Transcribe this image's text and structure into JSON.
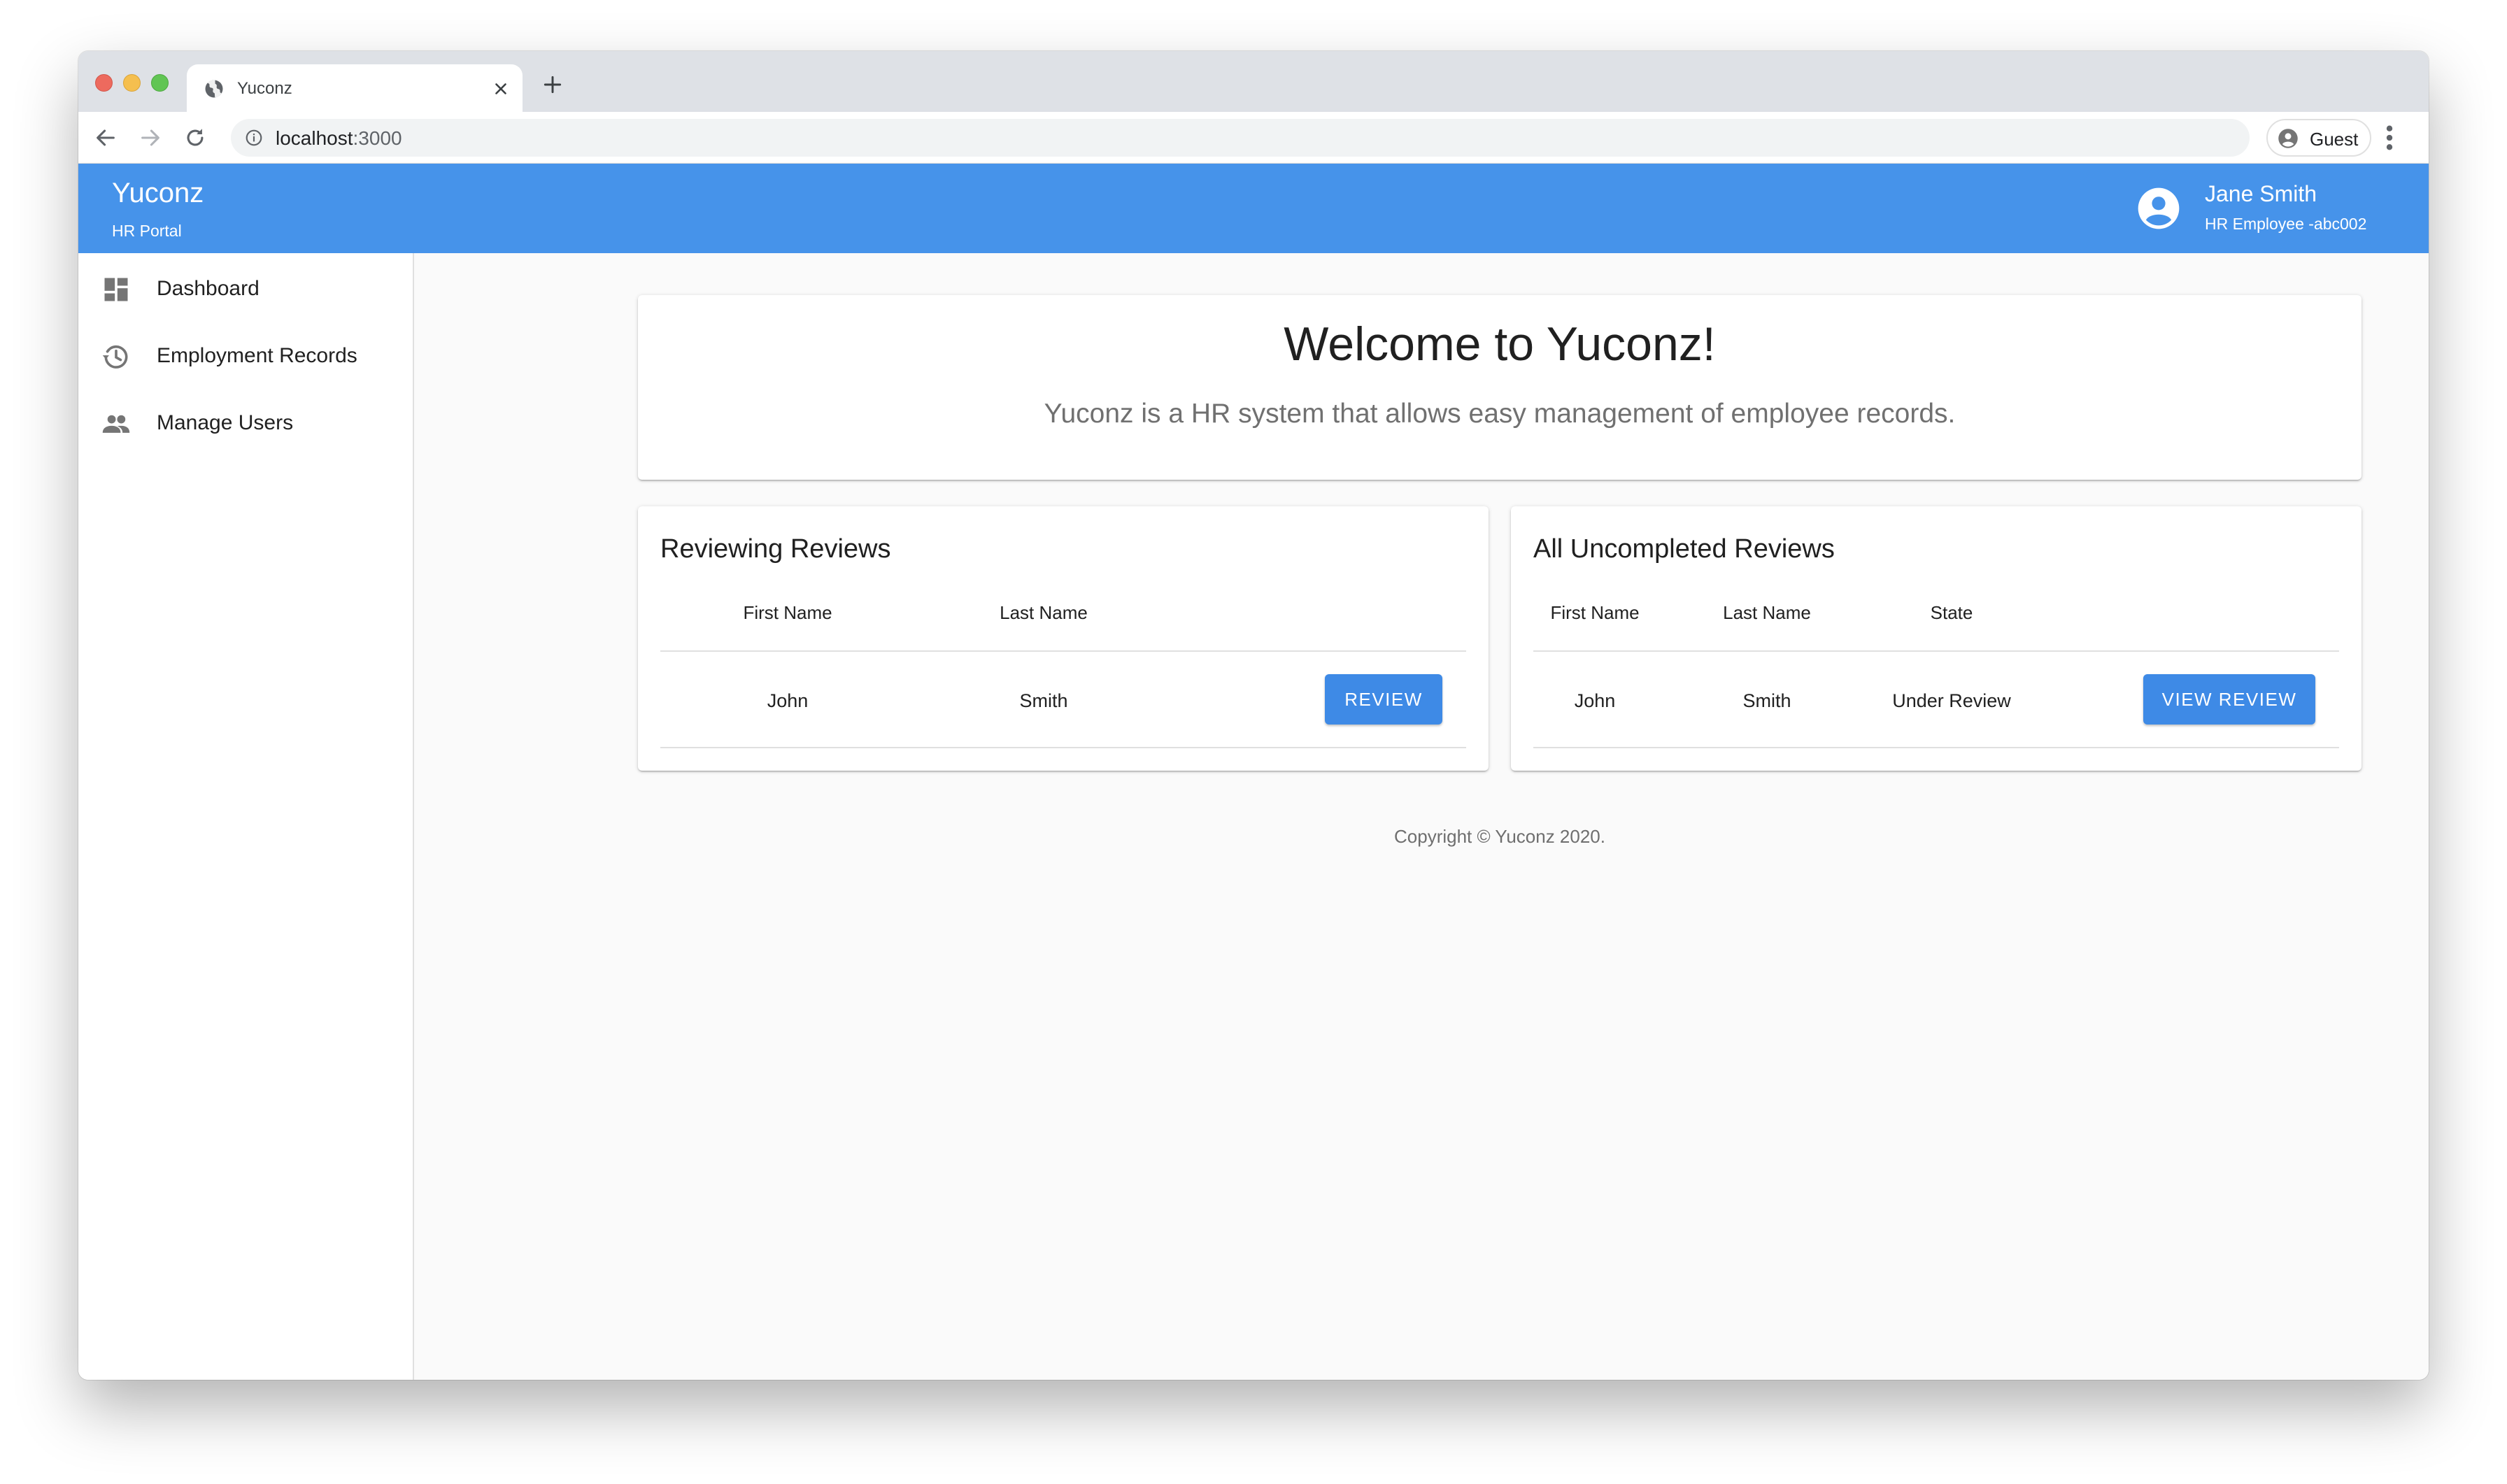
{
  "browser": {
    "tab_title": "Yuconz",
    "url_host": "localhost",
    "url_port": ":3000",
    "profile_label": "Guest"
  },
  "app": {
    "brand": "Yuconz",
    "brand_subtitle": "HR Portal",
    "user_name": "Jane Smith",
    "user_role": "HR Employee -abc002",
    "accent_color": "#4693ea"
  },
  "sidebar": {
    "items": [
      {
        "label": "Dashboard",
        "icon": "dashboard-icon"
      },
      {
        "label": "Employment Records",
        "icon": "history-icon"
      },
      {
        "label": "Manage Users",
        "icon": "people-icon"
      }
    ]
  },
  "welcome": {
    "title": "Welcome to Yuconz!",
    "text": "Yuconz is a HR system that allows easy management of employee records."
  },
  "reviewing": {
    "title": "Reviewing Reviews",
    "columns": [
      "First Name",
      "Last Name"
    ],
    "rows": [
      {
        "first_name": "John",
        "last_name": "Smith",
        "action": "REVIEW"
      }
    ]
  },
  "uncompleted": {
    "title": "All Uncompleted Reviews",
    "columns": [
      "First Name",
      "Last Name",
      "State"
    ],
    "rows": [
      {
        "first_name": "John",
        "last_name": "Smith",
        "state": "Under Review",
        "action": "VIEW REVIEW"
      }
    ]
  },
  "footer": {
    "copyright": "Copyright © Yuconz 2020."
  }
}
